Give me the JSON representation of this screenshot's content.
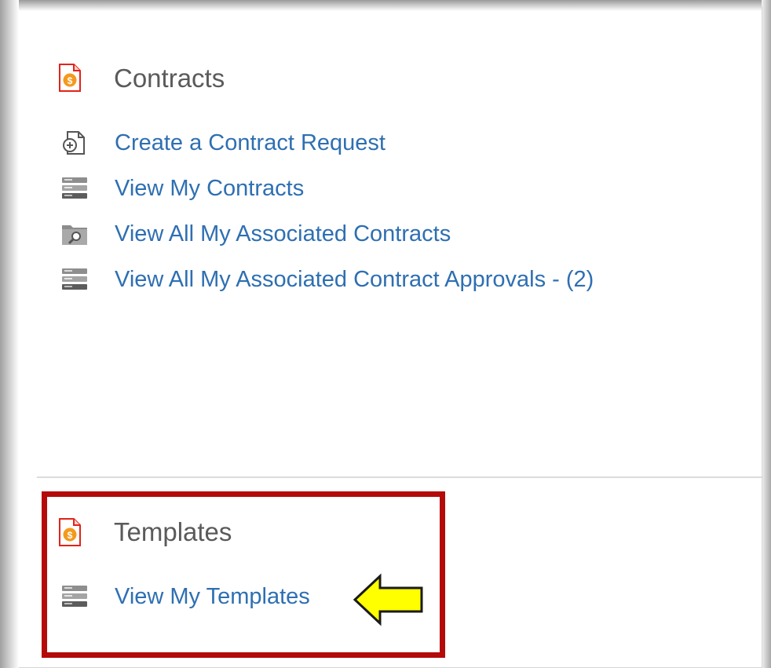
{
  "contracts": {
    "title": "Contracts",
    "header_icon": "contract-doc-icon",
    "links": [
      {
        "label": "Create a Contract Request",
        "icon": "new-document-icon"
      },
      {
        "label": "View My Contracts",
        "icon": "list-icon"
      },
      {
        "label": "View All My Associated Contracts",
        "icon": "folder-search-icon"
      },
      {
        "label": "View All My Associated Contract Approvals - (2)",
        "icon": "list-icon"
      }
    ]
  },
  "templates": {
    "title": "Templates",
    "header_icon": "contract-doc-icon",
    "links": [
      {
        "label": "View My Templates",
        "icon": "list-icon"
      }
    ]
  },
  "annotation": {
    "highlight_color": "#b40a0a",
    "arrow_color": "#ffff00"
  }
}
